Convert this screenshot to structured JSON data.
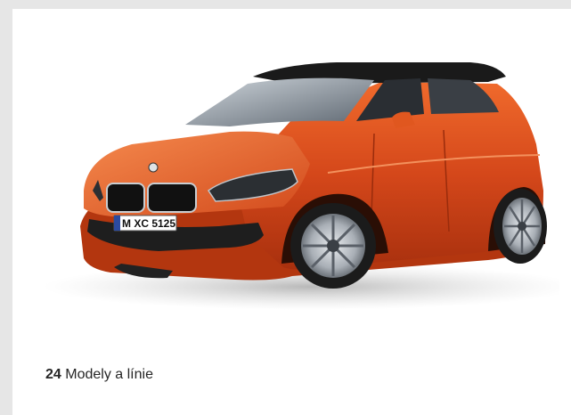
{
  "card": {
    "count": "24",
    "label": "Modely a línie"
  },
  "image": {
    "plate_text": "M XC 5125",
    "car_color": "#d4471a"
  }
}
